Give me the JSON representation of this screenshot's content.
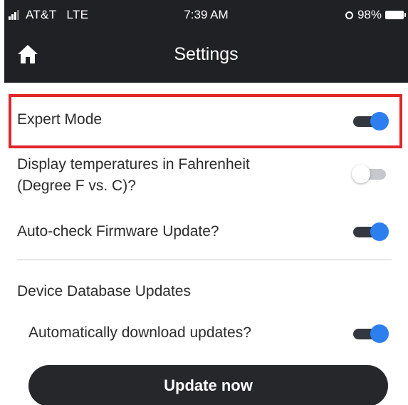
{
  "status_bar": {
    "carrier": "AT&T",
    "network": "LTE",
    "time": "7:39 AM",
    "battery_percent": "98%"
  },
  "header": {
    "title": "Settings",
    "home_icon": "home-icon"
  },
  "settings": {
    "expert_mode": {
      "label": "Expert Mode",
      "enabled": true,
      "highlighted": true
    },
    "fahrenheit": {
      "label_line1": "Display temperatures in Fahrenheit",
      "label_line2": "(Degree F vs. C)?",
      "enabled": false
    },
    "firmware": {
      "label": "Auto-check Firmware Update?",
      "enabled": true
    },
    "database_section": {
      "title": "Device Database Updates"
    },
    "auto_download": {
      "label": "Automatically download updates?",
      "enabled": true
    }
  },
  "actions": {
    "update_now_label": "Update now"
  },
  "colors": {
    "header_bg": "#202124",
    "toggle_on_knob": "#2d7ff0",
    "toggle_on_track": "#333840",
    "toggle_off_track": "#c5c8cc",
    "highlight_border": "#e1262c",
    "button_bg": "#25272b"
  }
}
